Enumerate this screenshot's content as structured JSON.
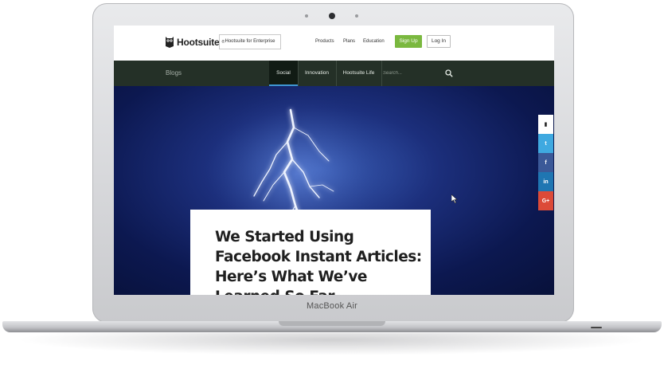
{
  "device": {
    "label": "MacBook Air"
  },
  "site": {
    "logo_text": "Hootsuite",
    "logo_mark": "®",
    "enterprise_button": "Hootsuite for Enterprise",
    "nav": [
      "Products",
      "Plans",
      "Education"
    ],
    "signup_label": "Sign Up",
    "login_label": "Log In"
  },
  "blog_nav": {
    "title": "Blogs",
    "tabs": [
      {
        "label": "Social",
        "active": true
      },
      {
        "label": "Innovation",
        "active": false
      },
      {
        "label": "Hootsuite Life",
        "active": false
      }
    ],
    "search_placeholder": "Search..."
  },
  "article": {
    "headline": "We Started Using Facebook Instant Articles: Here’s What We’ve Learned So Far"
  },
  "share_bar": [
    {
      "icon": "bookmark-icon",
      "glyph": "▮",
      "color": "#ffffff"
    },
    {
      "icon": "twitter-icon",
      "glyph": "t",
      "color": "#3fa9e0"
    },
    {
      "icon": "facebook-icon",
      "glyph": "f",
      "color": "#3b5998"
    },
    {
      "icon": "linkedin-icon",
      "glyph": "in",
      "color": "#1f76b2"
    },
    {
      "icon": "google-plus-icon",
      "glyph": "G+",
      "color": "#dc4a38"
    }
  ],
  "colors": {
    "brand_green": "#7ab83f",
    "nav_bg": "#243027",
    "active_tab_underline": "#3f97d4"
  }
}
